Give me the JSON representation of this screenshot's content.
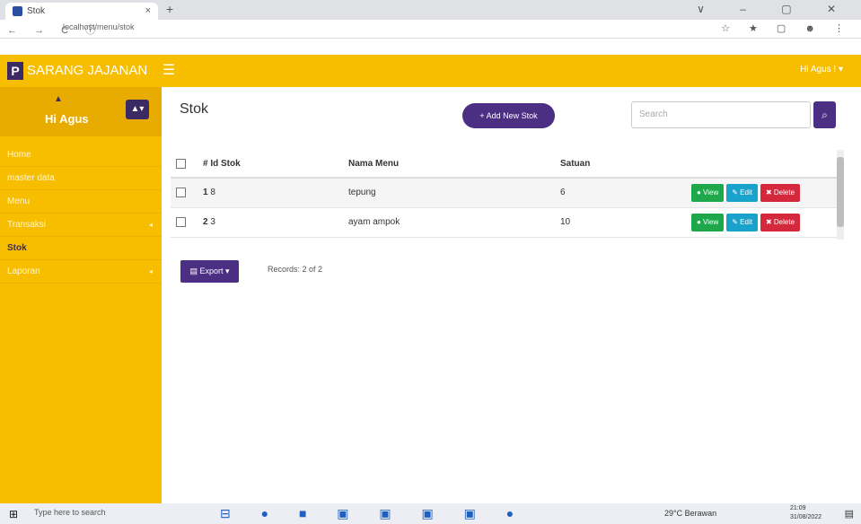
{
  "browser": {
    "tab_title": "Stok",
    "url": "localhost/menu/stok",
    "new_tab": "+",
    "nav": "← → C ⓘ",
    "win_controls": "∨ – ▢ ✕",
    "browser_icons": "☆ ★ ▢ ☻ ⋮"
  },
  "app": {
    "brand_icon": "P",
    "brand": "SARANG JAJANAN",
    "hamburger": "☰",
    "top_user": "Hi Agus ! ▾"
  },
  "sidebar": {
    "user_icon": "▲",
    "user_name": "Hi Agus",
    "user_dropdown": "▲▾",
    "items": [
      {
        "label": "Home",
        "caret": ""
      },
      {
        "label": "master data",
        "caret": ""
      },
      {
        "label": "Menu",
        "caret": ""
      },
      {
        "label": "Transaksi",
        "caret": "◂"
      },
      {
        "label": "Stok",
        "caret": ""
      },
      {
        "label": "Laporan",
        "caret": "◂"
      }
    ]
  },
  "main": {
    "title": "Stok",
    "add_button": "+ Add New Stok",
    "search_placeholder": "Search",
    "search_icon": "⌕",
    "columns": [
      "# Id Stok",
      "Nama Menu",
      "Satuan"
    ],
    "rows": [
      {
        "no": "1",
        "id": "8",
        "nama": "tepung",
        "satuan": "6"
      },
      {
        "no": "2",
        "id": "3",
        "nama": "ayam ampok",
        "satuan": "10"
      }
    ],
    "actions": {
      "view": "● View",
      "edit": "✎ Edit",
      "delete": "✖ Delete"
    },
    "export_button": "▤ Export ▾",
    "records": "Records: 2 of 2"
  },
  "taskbar": {
    "start": "⊞",
    "search": "Type here to search",
    "apps": "⊟ ● ■ ▣ ▣ ▣ ▣ ●",
    "weather": "29°C Berawan",
    "time": "21:09",
    "date": "31/08/2022",
    "notif": "▤"
  }
}
